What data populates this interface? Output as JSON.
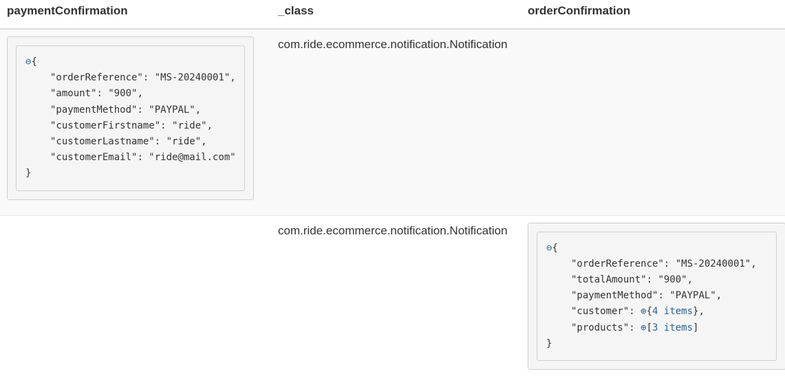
{
  "table": {
    "headers": [
      "paymentConfirmation",
      "_class",
      "orderConfirmation"
    ],
    "rows": [
      {
        "class_value": "com.ride.ecommerce.notification.Notification",
        "payment": {
          "collapse_icon": "⊖",
          "open": "{",
          "close": "}",
          "lines": [
            {
              "key": "\"orderReference\"",
              "value": "\"MS-20240001\"",
              "comma": ","
            },
            {
              "key": "\"amount\"",
              "value": "\"900\"",
              "comma": ","
            },
            {
              "key": "\"paymentMethod\"",
              "value": "\"PAYPAL\"",
              "comma": ","
            },
            {
              "key": "\"customerFirstname\"",
              "value": "\"ride\"",
              "comma": ","
            },
            {
              "key": "\"customerLastname\"",
              "value": "\"ride\"",
              "comma": ","
            },
            {
              "key": "\"customerEmail\"",
              "value": "\"ride@mail.com\"",
              "comma": ""
            }
          ]
        }
      },
      {
        "class_value": "com.ride.ecommerce.notification.Notification",
        "order": {
          "collapse_icon": "⊖",
          "open": "{",
          "close": "}",
          "lines": [
            {
              "key": "\"orderReference\"",
              "value": "\"MS-20240001\"",
              "comma": ","
            },
            {
              "key": "\"totalAmount\"",
              "value": "\"900\"",
              "comma": ","
            },
            {
              "key": "\"paymentMethod\"",
              "value": "\"PAYPAL\"",
              "comma": ","
            }
          ],
          "customer": {
            "key": "\"customer\"",
            "expand_icon": "⊕",
            "open": "{",
            "summary": "4 items",
            "close": "}",
            "comma": ","
          },
          "products": {
            "key": "\"products\"",
            "expand_icon": "⊕",
            "open": "[",
            "summary": "3 items",
            "close": "]",
            "comma": ""
          }
        }
      }
    ]
  },
  "colors": {
    "link": "#2a6496",
    "stripe": "#f9f9f9",
    "box_bg": "#f5f5f5"
  }
}
